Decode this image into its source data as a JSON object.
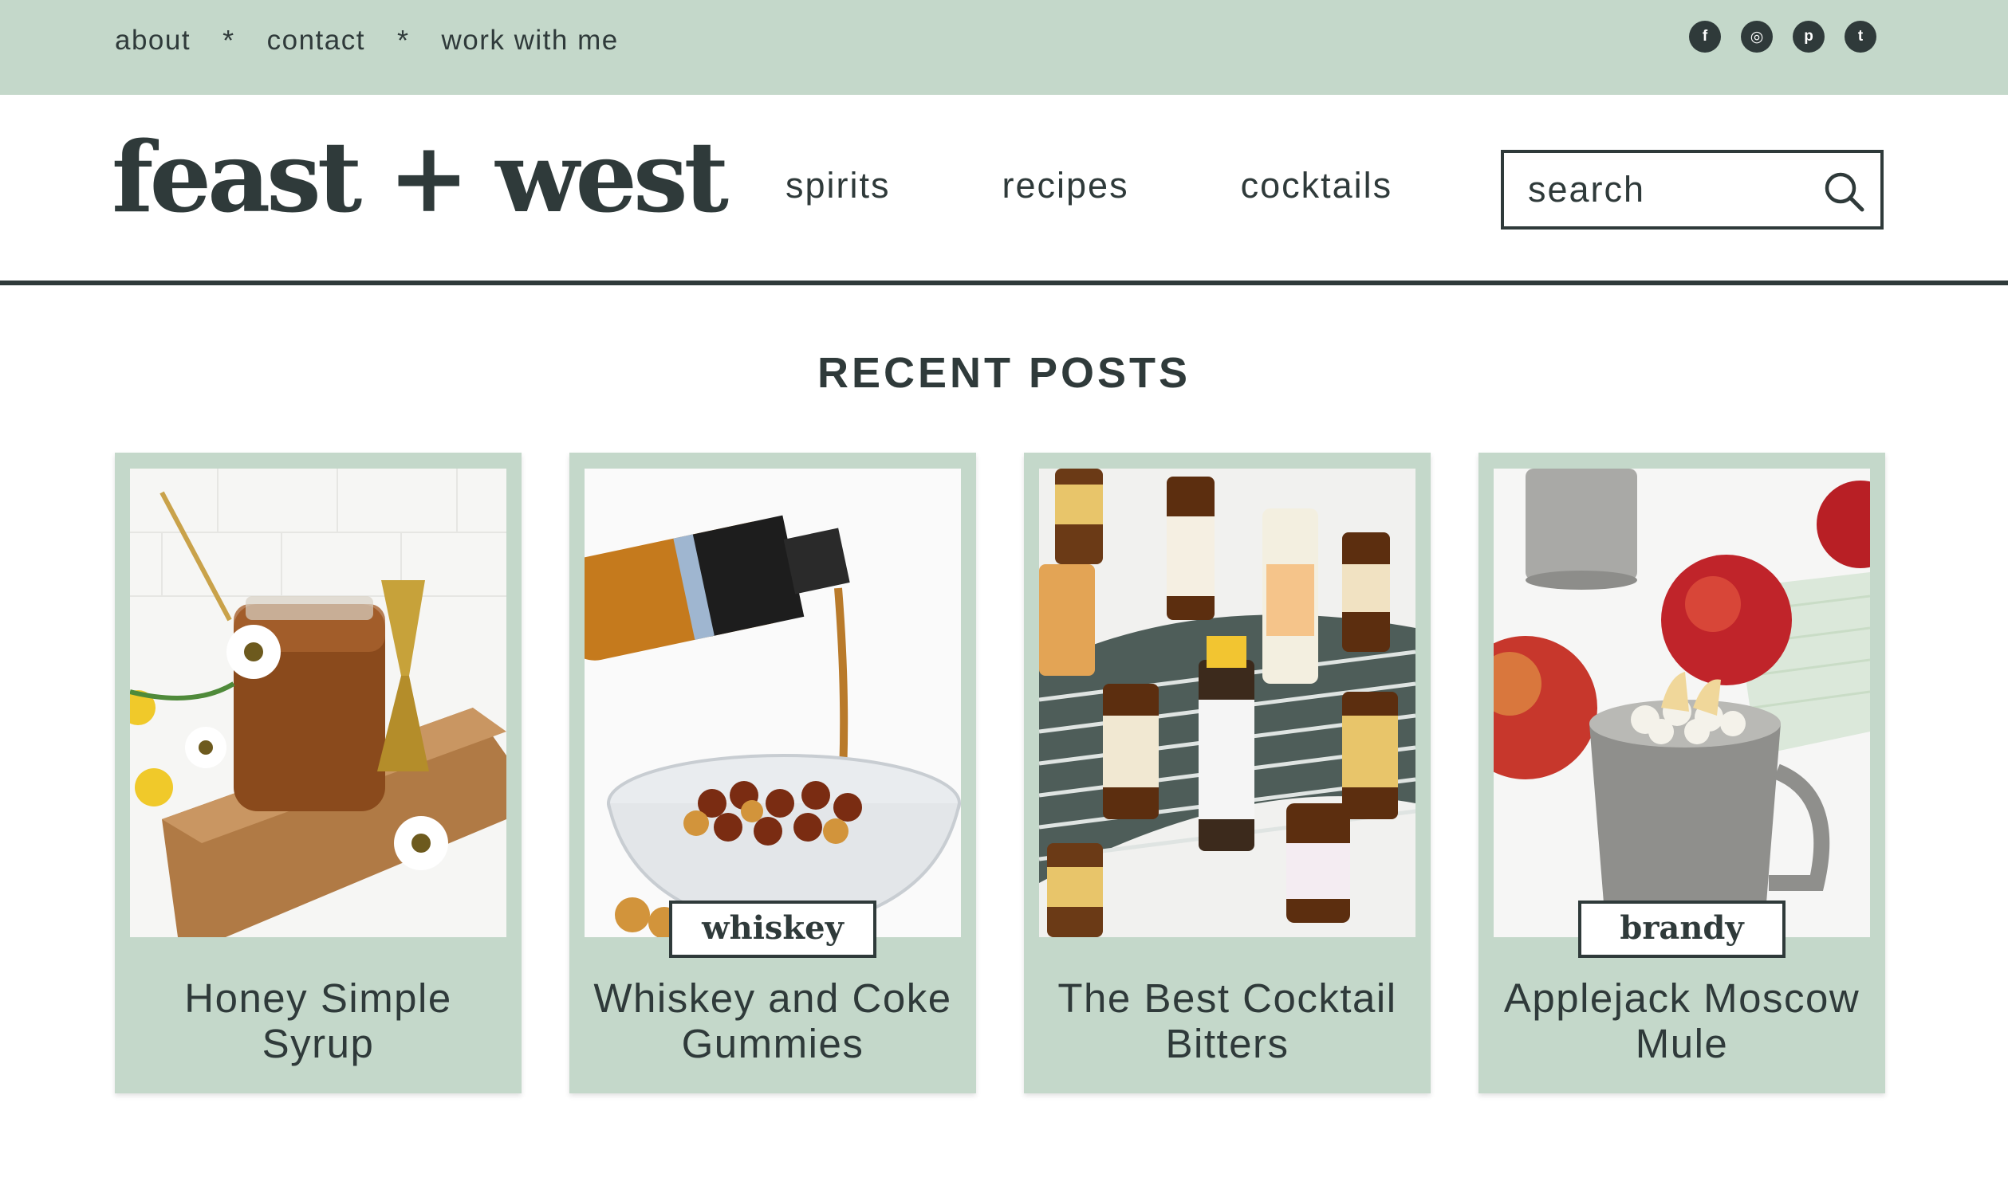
{
  "topbar": {
    "links": [
      "about",
      "contact",
      "work with me"
    ],
    "separator": "*",
    "social": [
      {
        "icon": "facebook-icon",
        "glyph": "f"
      },
      {
        "icon": "instagram-icon",
        "glyph": "◎"
      },
      {
        "icon": "pinterest-icon",
        "glyph": "p"
      },
      {
        "icon": "twitter-icon",
        "glyph": "t"
      }
    ]
  },
  "header": {
    "logo": "feast + west",
    "nav": [
      "spirits",
      "recipes",
      "cocktails"
    ],
    "search_placeholder": "search"
  },
  "main": {
    "section_title": "RECENT POSTS",
    "posts": [
      {
        "title": "Honey Simple Syrup",
        "badge": ""
      },
      {
        "title": "Whiskey and Coke Gummies",
        "badge": "whiskey"
      },
      {
        "title": "The Best Cocktail Bitters",
        "badge": ""
      },
      {
        "title": "Applejack Moscow Mule",
        "badge": "brandy"
      }
    ]
  },
  "colors": {
    "accent": "#c4d8ca",
    "text": "#2f3a3a",
    "background": "#ffffff"
  }
}
